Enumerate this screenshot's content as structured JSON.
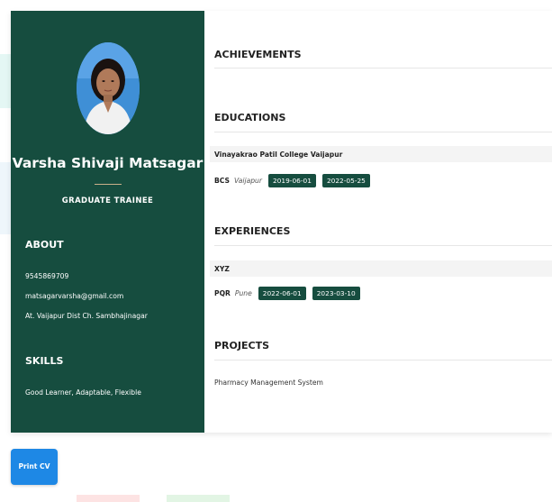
{
  "profile": {
    "name": "Varsha Shivaji Matsagar",
    "role": "GRADUATE TRAINEE",
    "avatar_icon": "person-photo"
  },
  "about": {
    "heading": "ABOUT",
    "phone": "9545869709",
    "email": "matsagarvarsha@gmail.com",
    "address": "At. Vaijapur Dist Ch. Sambhajinagar"
  },
  "skills": {
    "heading": "SKILLS",
    "text": "Good Learner, Adaptable, Flexible"
  },
  "achievements": {
    "heading": "ACHIEVEMENTS"
  },
  "educations": {
    "heading": "EDUCATIONS",
    "items": [
      {
        "institution": "Vinayakrao Patil College Vaijapur",
        "degree": "BCS",
        "place": "Vaijapur",
        "start": "2019-06-01",
        "end": "2022-05-25"
      }
    ]
  },
  "experiences": {
    "heading": "EXPERIENCES",
    "items": [
      {
        "company": "XYZ",
        "position": "PQR",
        "place": "Pune",
        "start": "2022-06-01",
        "end": "2023-03-10"
      }
    ]
  },
  "projects": {
    "heading": "PROJECTS",
    "items": [
      "Pharmacy Management System"
    ]
  },
  "actions": {
    "print_label": "Print CV"
  },
  "colors": {
    "sidebar": "#164d3f",
    "badge": "#164d3f",
    "button": "#1e88e5"
  }
}
